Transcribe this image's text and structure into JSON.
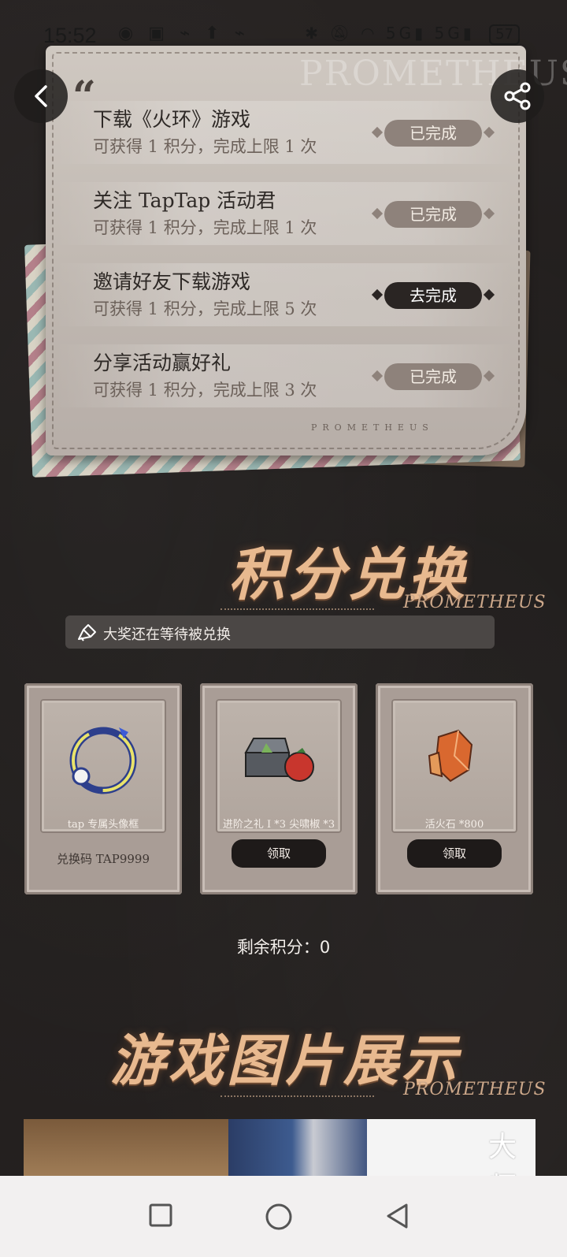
{
  "status_bar": {
    "time": "15:52",
    "network_5g_1": "5G",
    "network_5g_2": "5G",
    "battery": "57"
  },
  "header": {
    "back_icon": "chevron-left-icon",
    "share_icon": "share-icon"
  },
  "task_card": {
    "watermark": "PROMETHEUS",
    "footer": "PROMETHEUS",
    "tasks": [
      {
        "title": "下载《火环》游戏",
        "desc": "可获得 1 积分，完成上限 1 次",
        "button": "已完成"
      },
      {
        "title": "关注 TapTap 活动君",
        "desc": "可获得 1 积分，完成上限 1 次",
        "button": "已完成"
      },
      {
        "title": "邀请好友下载游戏",
        "desc": "可获得 1 积分，完成上限 5 次",
        "button": "去完成"
      },
      {
        "title": "分享活动赢好礼",
        "desc": "可获得 1 积分，完成上限 3 次",
        "button": "已完成"
      }
    ]
  },
  "exchange": {
    "heading": "积分兑换",
    "heading_sub": "PROMETHEUS",
    "notice": "大奖还在等待被兑换",
    "rewards": [
      {
        "label": "tap 专属头像框",
        "code": "兑换码 TAP9999"
      },
      {
        "label": "进阶之礼 I *3 尖啸椒 *3",
        "button": "领取"
      },
      {
        "label": "活火石 *800",
        "button": "领取"
      }
    ],
    "points_label": "剩余积分：",
    "points_value": "0"
  },
  "gallery": {
    "heading": "游戏图片展示",
    "heading_sub": "PROMETHEUS",
    "badge": "大师"
  },
  "colors": {
    "background": "#221f1e",
    "heading": "#e8b98f",
    "button_done": "#8e827b",
    "button_go": "#2a2523"
  }
}
